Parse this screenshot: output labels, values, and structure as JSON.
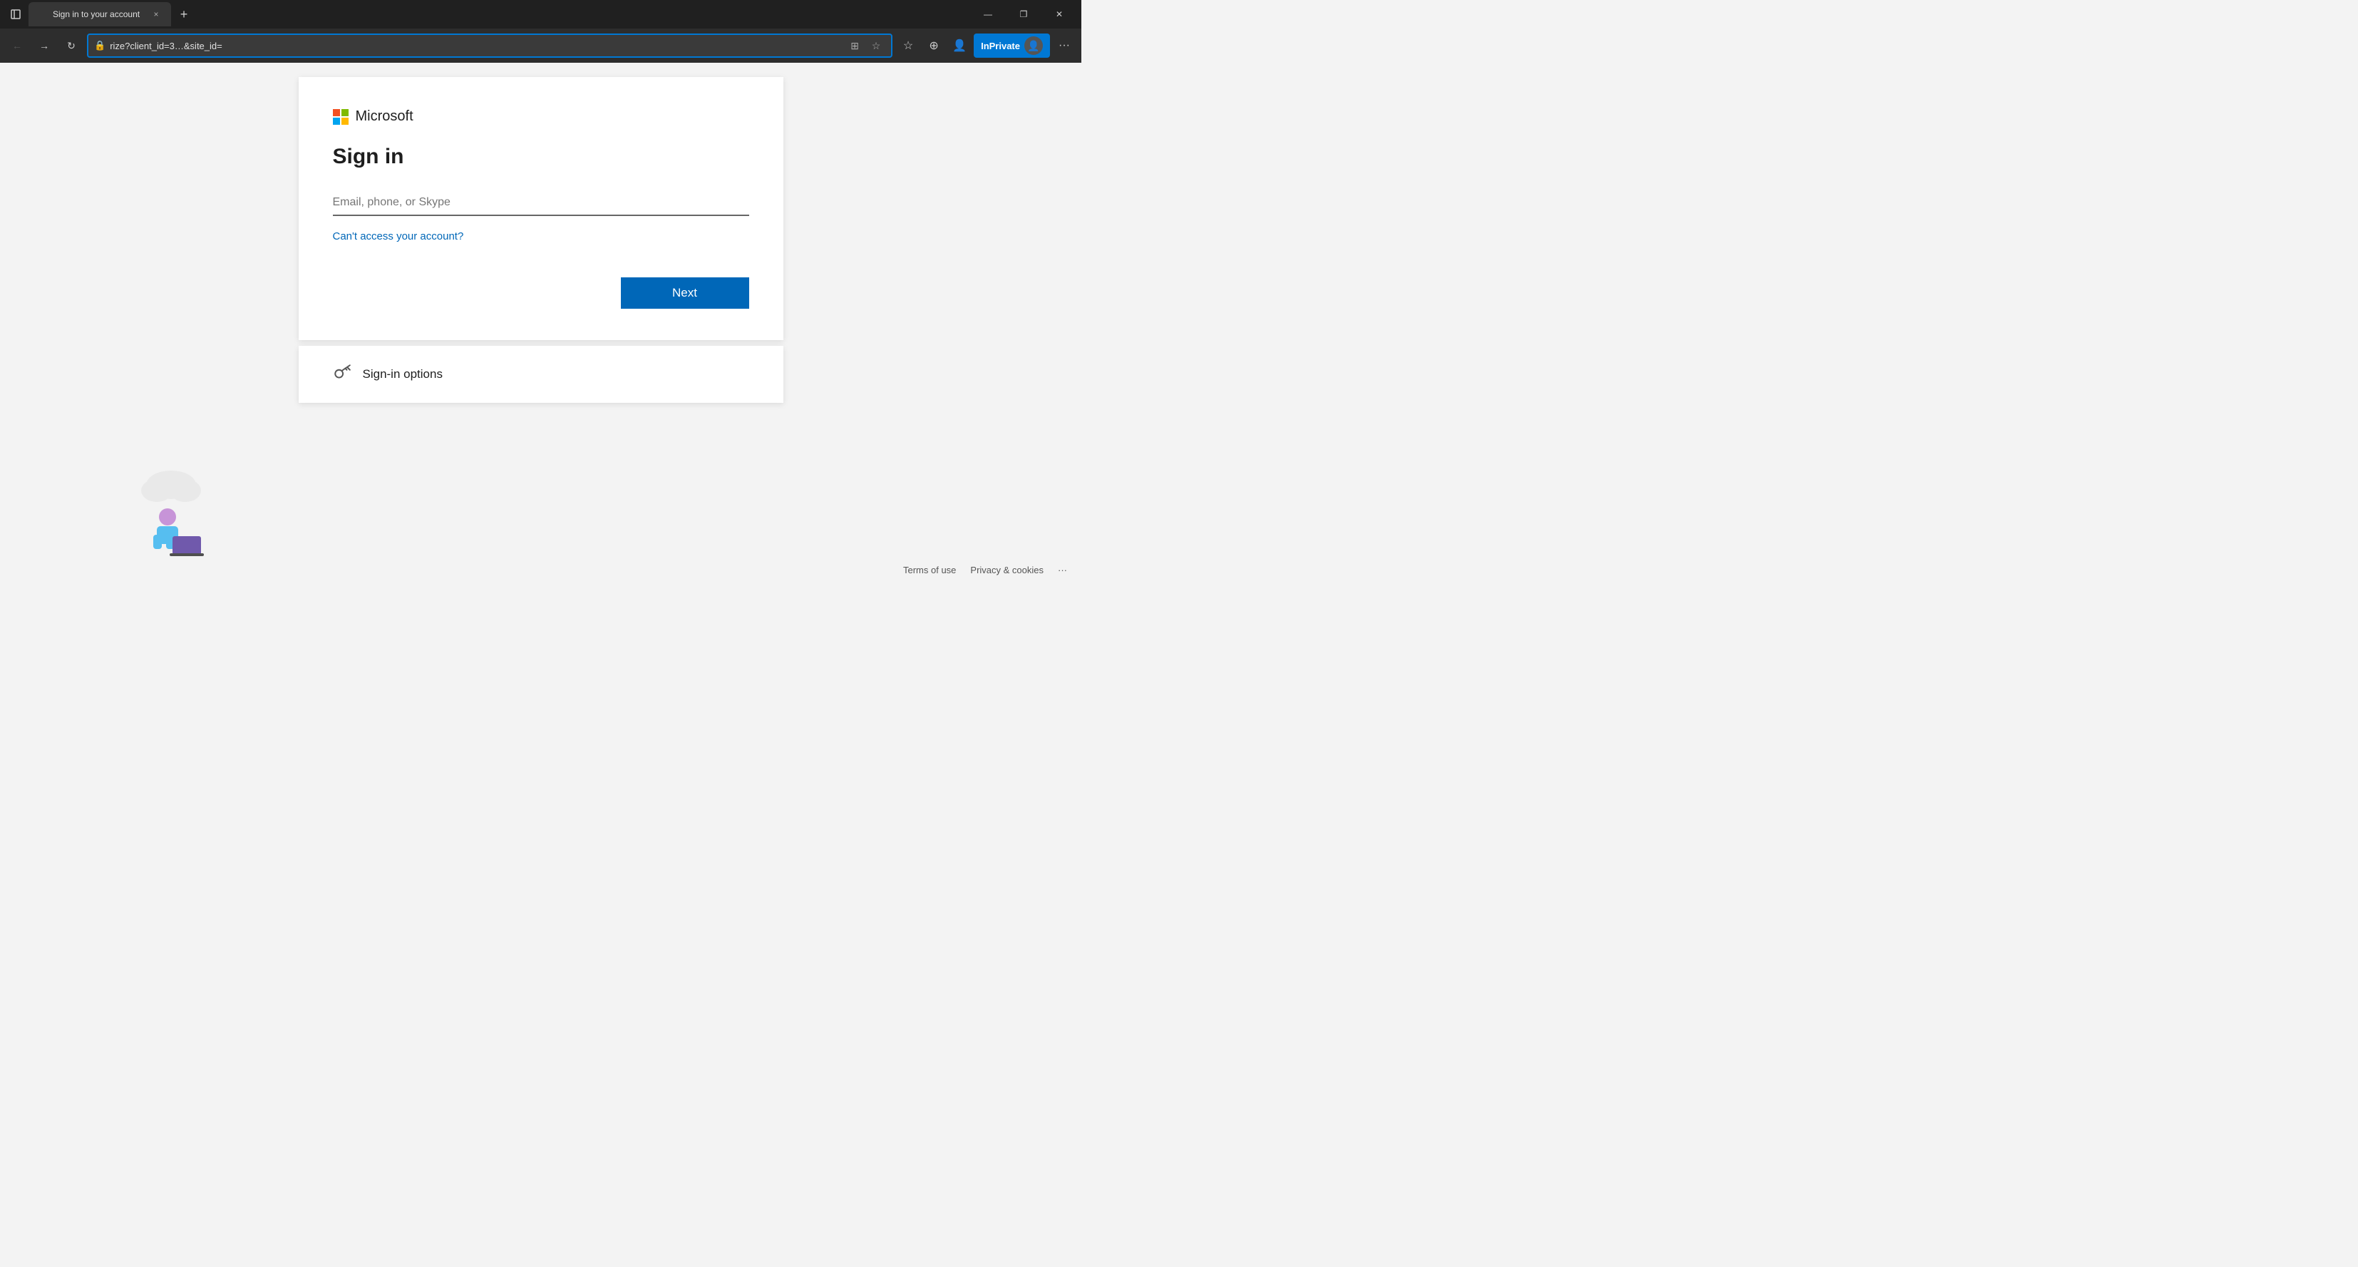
{
  "browser": {
    "tab": {
      "favicon_alt": "Microsoft logo",
      "title": "Sign in to your account",
      "close_label": "×"
    },
    "new_tab_label": "+",
    "window_controls": {
      "minimize": "—",
      "maximize": "❐",
      "close": "✕"
    },
    "address_bar": {
      "url": "rize?client_id=3…&site_id=",
      "lock_icon": "🔒"
    },
    "toolbar": {
      "favorites_label": "☆",
      "collections_label": "⊕",
      "profile_label": "👤",
      "inprivate_label": "InPrivate",
      "more_label": "···"
    }
  },
  "page": {
    "ms_logo_text": "Microsoft",
    "signin_title": "Sign in",
    "email_placeholder": "Email, phone, or Skype",
    "cant_access_text": "Can't access your account?",
    "next_button": "Next",
    "signin_options_text": "Sign-in options"
  },
  "footer": {
    "terms": "Terms of use",
    "privacy": "Privacy & cookies",
    "dots": "···"
  }
}
